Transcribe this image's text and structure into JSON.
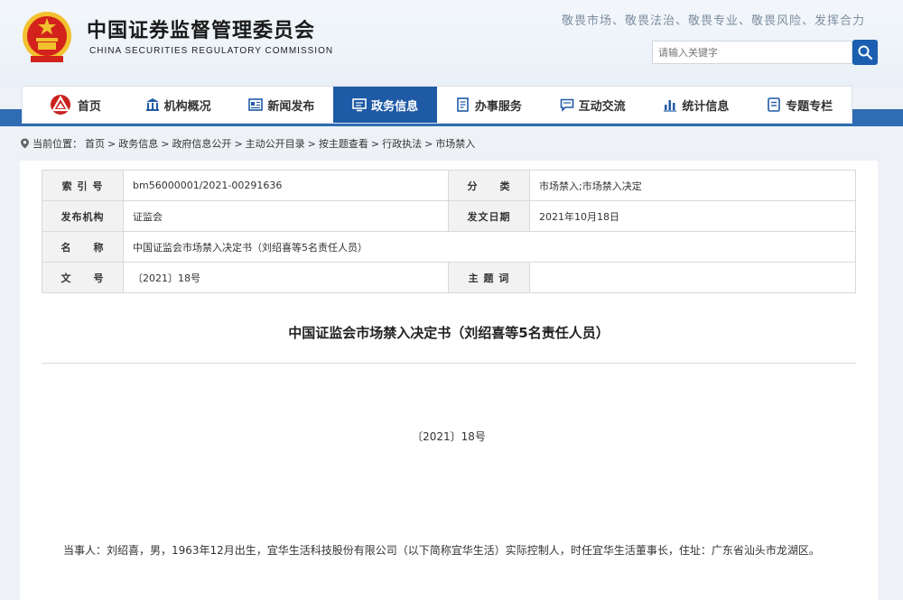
{
  "header": {
    "org_name_cn": "中国证券监督管理委员会",
    "org_name_en": "CHINA SECURITIES REGULATORY COMMISSION",
    "slogan": "敬畏市场、敬畏法治、敬畏专业、敬畏风险、发挥合力",
    "search_placeholder": "请输入关键字",
    "emblem_icon": "national-emblem-icon"
  },
  "nav": {
    "items": [
      {
        "label": "首页",
        "icon": "home-logo-icon"
      },
      {
        "label": "机构概况",
        "icon": "building-icon"
      },
      {
        "label": "新闻发布",
        "icon": "news-icon"
      },
      {
        "label": "政务信息",
        "icon": "monitor-icon",
        "active": true
      },
      {
        "label": "办事服务",
        "icon": "document-icon"
      },
      {
        "label": "互动交流",
        "icon": "chat-icon"
      },
      {
        "label": "统计信息",
        "icon": "bar-chart-icon"
      },
      {
        "label": "专题专栏",
        "icon": "list-icon"
      }
    ],
    "active_color": "#1f5aa6"
  },
  "breadcrumb": {
    "prefix": "当前位置：",
    "items": [
      "首页",
      "政务信息",
      "政府信息公开",
      "主动公开目录",
      "按主题查看",
      "行政执法",
      "市场禁入"
    ],
    "separator": ">"
  },
  "meta": {
    "index_label": "索 引 号",
    "index_value": "bm56000001/2021-00291636",
    "category_label": "分　　类",
    "category_value": "市场禁入;市场禁入决定",
    "issuer_label": "发布机构",
    "issuer_value": "证监会",
    "date_label": "发文日期",
    "date_value": "2021年10月18日",
    "name_label": "名　　称",
    "name_value": "中国证监会市场禁入决定书（刘绍喜等5名责任人员）",
    "docno_label": "文　　号",
    "docno_value": "〔2021〕18号",
    "keyword_label": "主 题 词",
    "keyword_value": ""
  },
  "document": {
    "title": "中国证监会市场禁入决定书（刘绍喜等5名责任人员）",
    "number": "〔2021〕18号",
    "paragraph1": "当事人：刘绍喜，男，1963年12月出生，宜华生活科技股份有限公司（以下简称宜华生活）实际控制人，时任宜华生活董事长，住址：广东省汕头市龙湖区。"
  },
  "colors": {
    "brand_blue": "#1f5aa6",
    "bar_blue": "#2f6cb3",
    "emblem_red": "#d3221c",
    "emblem_gold": "#f2c12e"
  }
}
